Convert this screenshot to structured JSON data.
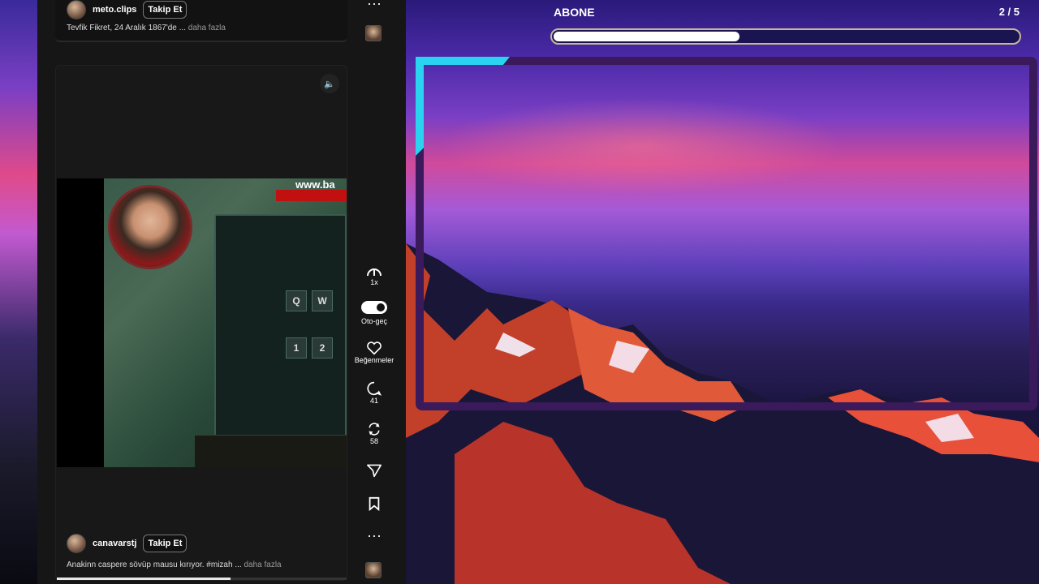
{
  "feed": {
    "top_post": {
      "username": "meto.clips",
      "follow_label": "Takip Et",
      "caption": "Tevfik Fikret, 24 Aralık 1867'de ...",
      "more_label": "daha fazla"
    },
    "main_post": {
      "username": "canavarstj",
      "follow_label": "Takip Et",
      "caption": "Anakinn caspere sövüp mausu kırıyor. #mizah ...",
      "more_label": "daha fazla",
      "progress": 0.6
    },
    "video": {
      "watermark": "www.ba",
      "keys": [
        "Q",
        "W",
        "1",
        "2"
      ]
    }
  },
  "rail": {
    "top_more": "···",
    "speed_label": "1x",
    "autoplay_label": "Oto-geç",
    "likes_label": "Beğenmeler",
    "comments_count": "41",
    "reposts_count": "58",
    "bottom_more": "···"
  },
  "icons": {
    "speed": "speedometer-icon",
    "autoplay": "toggle-icon",
    "like": "heart-icon",
    "comment": "comment-icon",
    "repost": "repost-icon",
    "share": "send-icon",
    "save": "bookmark-icon",
    "more": "more-icon",
    "sound": "speaker-icon"
  },
  "overlay": {
    "label": "ABONE",
    "count": "2 / 5",
    "progress": 0.4,
    "frame_color": "#3a1a5a",
    "accent_color": "#2ad4f0"
  }
}
